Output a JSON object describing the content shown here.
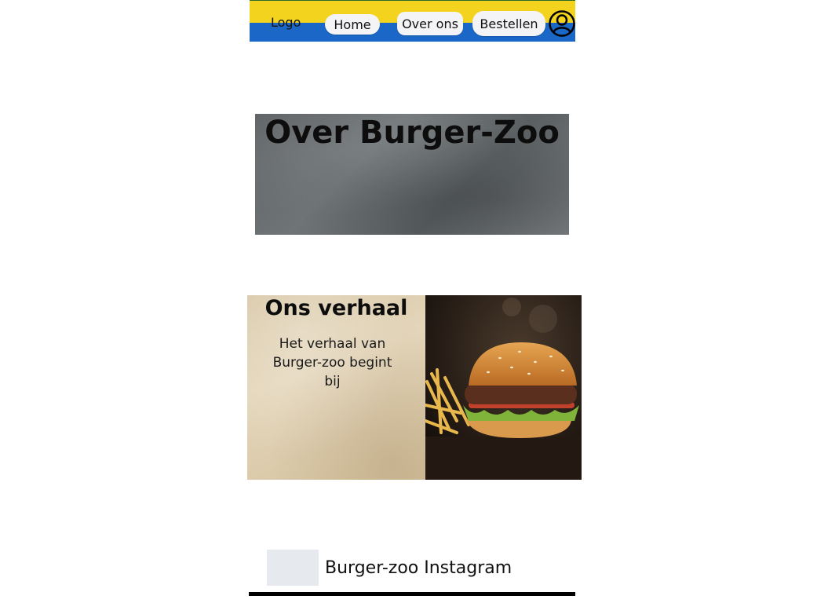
{
  "nav": {
    "logo": "Logo",
    "items": [
      {
        "label": "Home"
      },
      {
        "label": "Over ons"
      },
      {
        "label": "Bestellen"
      }
    ],
    "user_icon": "user-circle-icon"
  },
  "hero": {
    "title": "Over Burger-Zoo"
  },
  "story": {
    "title": "Ons verhaal",
    "text": "Het verhaal van Burger-zoo begint bij",
    "image": "burger-fries-photo"
  },
  "footer": {
    "instagram_label": "Burger-zoo Instagram"
  },
  "colors": {
    "nav_yellow": "#f3d31d",
    "nav_blue": "#1a67c8"
  }
}
